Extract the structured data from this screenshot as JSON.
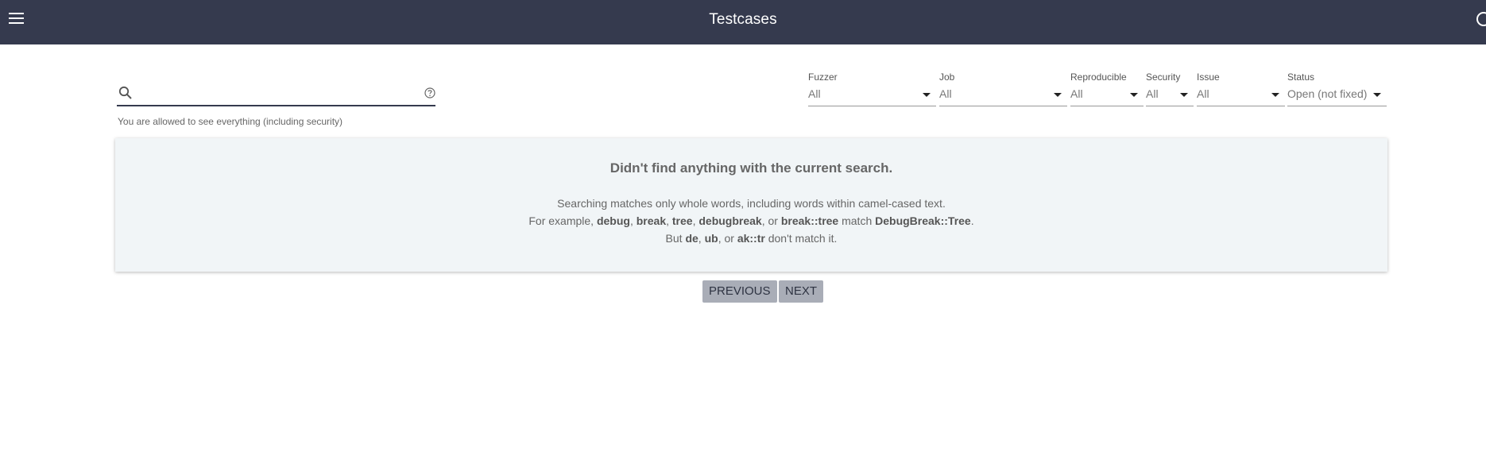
{
  "header": {
    "title": "Testcases"
  },
  "search": {
    "value": "",
    "placeholder": ""
  },
  "permission_note": "You are allowed to see everything (including security)",
  "filters": [
    {
      "label": "Fuzzer",
      "value": "All"
    },
    {
      "label": "Job",
      "value": "All"
    },
    {
      "label": "Reproducible",
      "value": "All"
    },
    {
      "label": "Security",
      "value": "All"
    },
    {
      "label": "Issue",
      "value": "All"
    },
    {
      "label": "Status",
      "value": "Open (not fixed)"
    }
  ],
  "empty_state": {
    "title": "Didn't find anything with the current search.",
    "line1": "Searching matches only whole words, including words within camel-cased text.",
    "line2": {
      "prefix": "For example, ",
      "w1": "debug",
      "s1": ", ",
      "w2": "break",
      "s2": ", ",
      "w3": "tree",
      "s3": ", ",
      "w4": "debugbreak",
      "s4": ", or ",
      "w5": "break::tree",
      "s5": " match ",
      "w6": "DebugBreak::Tree",
      "suffix": "."
    },
    "line3": {
      "prefix": "But ",
      "w1": "de",
      "s1": ", ",
      "w2": "ub",
      "s2": ", or ",
      "w3": "ak::tr",
      "suffix": " don't match it."
    }
  },
  "pagination": {
    "previous_label": "PREVIOUS",
    "next_label": "NEXT"
  },
  "colors": {
    "topbar": "#353a4e",
    "panel_bg": "#f1f5f7",
    "button_bg": "#a9adb7"
  },
  "icons": {
    "menu": "menu-icon",
    "search": "search-icon",
    "help": "help-icon",
    "account": "account-icon",
    "dropdown": "chevron-down-icon"
  }
}
